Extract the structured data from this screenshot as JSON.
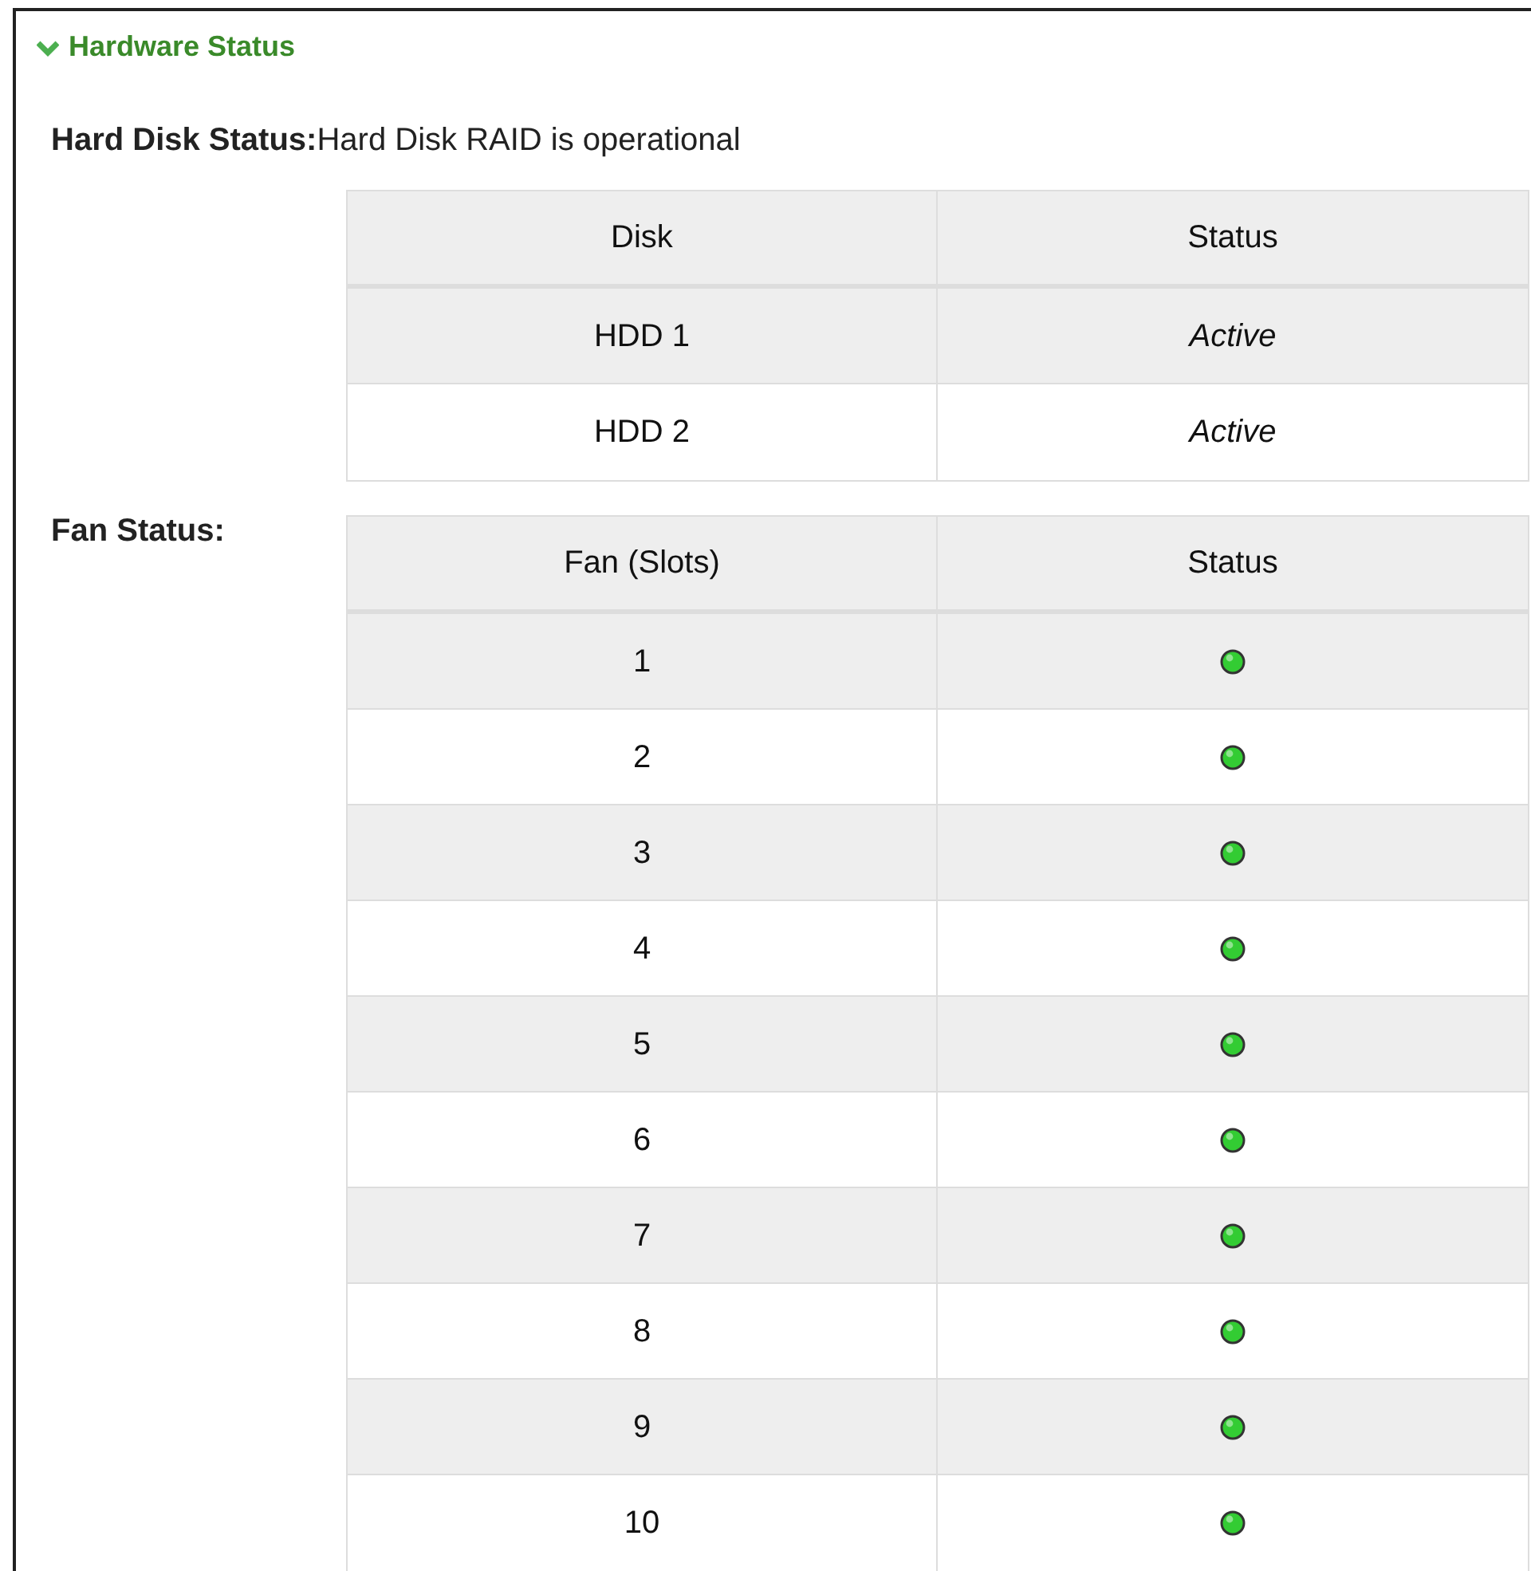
{
  "section": {
    "title": "Hardware Status",
    "expanded": true
  },
  "hard_disk": {
    "label": "Hard Disk Status:",
    "value": "Hard Disk RAID is operational",
    "columns": [
      "Disk",
      "Status"
    ],
    "rows": [
      {
        "disk": "HDD 1",
        "status": "Active"
      },
      {
        "disk": "HDD 2",
        "status": "Active"
      }
    ]
  },
  "fans": {
    "label": "Fan Status:",
    "columns": [
      "Fan (Slots)",
      "Status"
    ],
    "rows": [
      {
        "slot": "1",
        "color": "#33cc33"
      },
      {
        "slot": "2",
        "color": "#33cc33"
      },
      {
        "slot": "3",
        "color": "#33cc33"
      },
      {
        "slot": "4",
        "color": "#33cc33"
      },
      {
        "slot": "5",
        "color": "#33cc33"
      },
      {
        "slot": "6",
        "color": "#33cc33"
      },
      {
        "slot": "7",
        "color": "#33cc33"
      },
      {
        "slot": "8",
        "color": "#33cc33"
      },
      {
        "slot": "9",
        "color": "#33cc33"
      },
      {
        "slot": "10",
        "color": "#33cc33"
      }
    ]
  }
}
